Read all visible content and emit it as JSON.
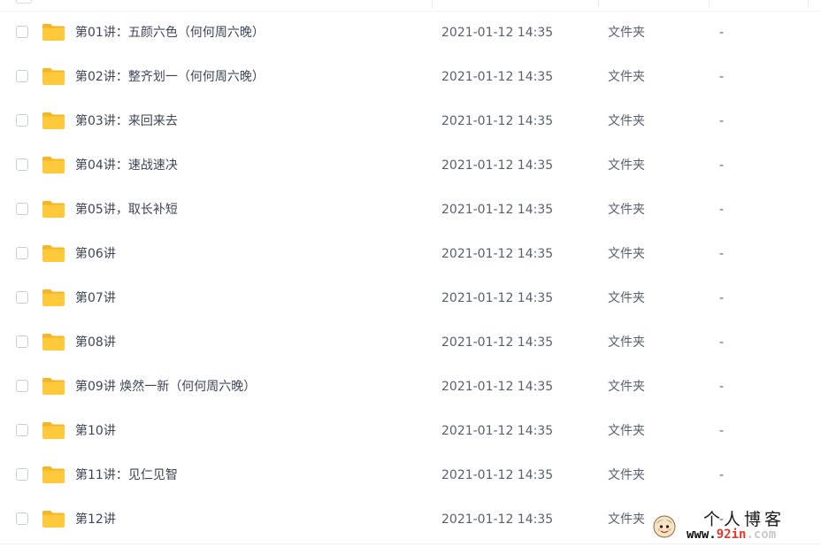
{
  "file_list": {
    "rows": [
      {
        "name": "第01讲：五颜六色（何何周六晚）",
        "modified": "2021-01-12 14:35",
        "type": "文件夹",
        "size": "-"
      },
      {
        "name": "第02讲：整齐划一（何何周六晚）",
        "modified": "2021-01-12 14:35",
        "type": "文件夹",
        "size": "-"
      },
      {
        "name": "第03讲：来回来去",
        "modified": "2021-01-12 14:35",
        "type": "文件夹",
        "size": "-"
      },
      {
        "name": "第04讲：速战速决",
        "modified": "2021-01-12 14:35",
        "type": "文件夹",
        "size": "-"
      },
      {
        "name": "第05讲，取长补短",
        "modified": "2021-01-12 14:35",
        "type": "文件夹",
        "size": "-"
      },
      {
        "name": "第06讲",
        "modified": "2021-01-12 14:35",
        "type": "文件夹",
        "size": "-"
      },
      {
        "name": "第07讲",
        "modified": "2021-01-12 14:35",
        "type": "文件夹",
        "size": "-"
      },
      {
        "name": "第08讲",
        "modified": "2021-01-12 14:35",
        "type": "文件夹",
        "size": "-"
      },
      {
        "name": "第09讲 焕然一新（何何周六晚）",
        "modified": "2021-01-12 14:35",
        "type": "文件夹",
        "size": "-"
      },
      {
        "name": "第10讲",
        "modified": "2021-01-12 14:35",
        "type": "文件夹",
        "size": "-"
      },
      {
        "name": "第11讲：见仁见智",
        "modified": "2021-01-12 14:35",
        "type": "文件夹",
        "size": "-"
      },
      {
        "name": "第12讲",
        "modified": "2021-01-12 14:35",
        "type": "文件夹",
        "size": "-"
      }
    ],
    "row_icon": "folder-icon",
    "checkbox_checked": false
  },
  "watermark": {
    "title": "个人博客",
    "url_prefix": "www.",
    "url_highlight": "92in",
    "url_suffix": ".com",
    "logo_icon": "blog-avatar-logo"
  },
  "colors": {
    "folder": "#ffc93c",
    "folder_back": "#f6b525",
    "text_primary": "#3d4556",
    "text_secondary": "#575f70",
    "url_highlight": "#e03a2f"
  }
}
